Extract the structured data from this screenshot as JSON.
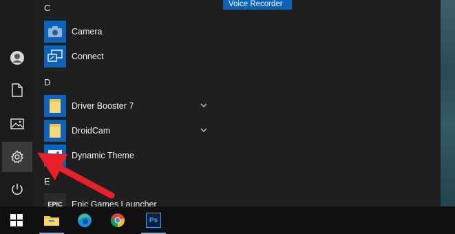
{
  "letters": {
    "c": "C",
    "d": "D",
    "e": "E"
  },
  "apps": {
    "camera": "Camera",
    "connect": "Connect",
    "driver_booster": "Driver Booster 7",
    "droidcam": "DroidCam",
    "dynamic_theme": "Dynamic Theme",
    "epic": "Epic Games Launcher",
    "epic_tile_text": "EPIC"
  },
  "tiles": {
    "voice_recorder": "Voice Recorder"
  },
  "rail": {
    "items": [
      "avatar",
      "documents-icon",
      "pictures-icon",
      "settings-icon",
      "power-icon"
    ],
    "active": "settings-icon"
  },
  "taskbar": {
    "apps": [
      "file-explorer-icon",
      "edge-icon",
      "chrome-icon",
      "photoshop-icon"
    ],
    "photoshop_text": "Ps"
  },
  "colors": {
    "accent": "#0a63b8",
    "arrow": "#e8202a"
  }
}
